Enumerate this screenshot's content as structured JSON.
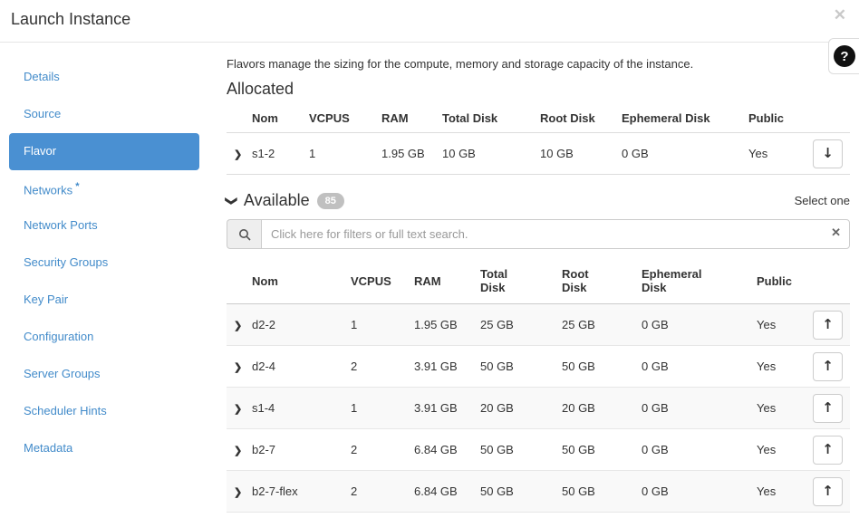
{
  "modal": {
    "title": "Launch Instance",
    "close_icon": "✕",
    "help_icon": "?"
  },
  "icons": {
    "expand_chevron": "❯",
    "collapse_chevron": "❯",
    "arrow_down": "↓",
    "arrow_up": "↑",
    "search": "magnifier",
    "clear": "✕"
  },
  "colors": {
    "accent": "#4a90d2",
    "link": "#428bca",
    "badge_bg": "#c0c0c0",
    "row_stripe": "#f9f9f9"
  },
  "sidebar": {
    "items": [
      {
        "label": "Details"
      },
      {
        "label": "Source"
      },
      {
        "label": "Flavor",
        "active": true
      },
      {
        "label": "Networks",
        "required": "*"
      },
      {
        "label": "Network Ports"
      },
      {
        "label": "Security Groups"
      },
      {
        "label": "Key Pair"
      },
      {
        "label": "Configuration"
      },
      {
        "label": "Server Groups"
      },
      {
        "label": "Scheduler Hints"
      },
      {
        "label": "Metadata"
      }
    ]
  },
  "main": {
    "description": "Flavors manage the sizing for the compute, memory and storage capacity of the instance.",
    "allocated": {
      "title": "Allocated",
      "columns": [
        "Nom",
        "VCPUS",
        "RAM",
        "Total Disk",
        "Root Disk",
        "Ephemeral Disk",
        "Public"
      ],
      "rows": [
        {
          "name": "s1-2",
          "vcpus": "1",
          "ram": "1.95 GB",
          "total_disk": "10 GB",
          "root_disk": "10 GB",
          "ephemeral_disk": "0 GB",
          "public": "Yes"
        }
      ]
    },
    "available": {
      "title": "Available",
      "count": "85",
      "select_hint": "Select one",
      "search_placeholder": "Click here for filters or full text search.",
      "columns": [
        "Nom",
        "VCPUS",
        "RAM",
        "Total Disk",
        "Root Disk",
        "Ephemeral Disk",
        "Public"
      ],
      "rows": [
        {
          "name": "d2-2",
          "vcpus": "1",
          "ram": "1.95 GB",
          "total_disk": "25 GB",
          "root_disk": "25 GB",
          "ephemeral_disk": "0 GB",
          "public": "Yes"
        },
        {
          "name": "d2-4",
          "vcpus": "2",
          "ram": "3.91 GB",
          "total_disk": "50 GB",
          "root_disk": "50 GB",
          "ephemeral_disk": "0 GB",
          "public": "Yes"
        },
        {
          "name": "s1-4",
          "vcpus": "1",
          "ram": "3.91 GB",
          "total_disk": "20 GB",
          "root_disk": "20 GB",
          "ephemeral_disk": "0 GB",
          "public": "Yes"
        },
        {
          "name": "b2-7",
          "vcpus": "2",
          "ram": "6.84 GB",
          "total_disk": "50 GB",
          "root_disk": "50 GB",
          "ephemeral_disk": "0 GB",
          "public": "Yes"
        },
        {
          "name": "b2-7-flex",
          "vcpus": "2",
          "ram": "6.84 GB",
          "total_disk": "50 GB",
          "root_disk": "50 GB",
          "ephemeral_disk": "0 GB",
          "public": "Yes"
        }
      ]
    }
  }
}
